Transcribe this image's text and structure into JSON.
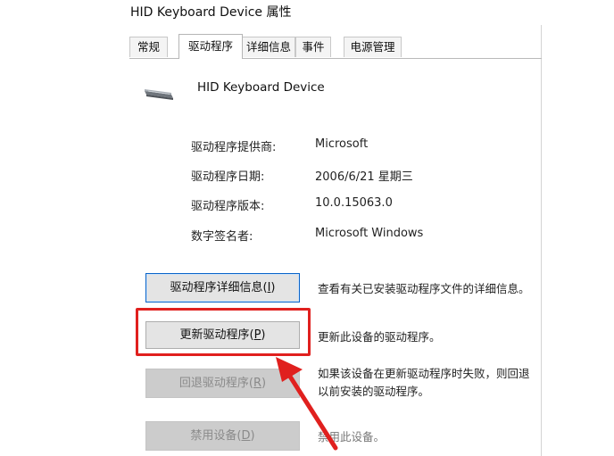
{
  "window": {
    "title": "HID Keyboard Device 属性"
  },
  "tabs": [
    {
      "label": "常规"
    },
    {
      "label": "驱动程序"
    },
    {
      "label": "详细信息"
    },
    {
      "label": "事件"
    },
    {
      "label": "电源管理"
    }
  ],
  "active_tab_index": 1,
  "device": {
    "name": "HID Keyboard Device",
    "icon": "keyboard-icon"
  },
  "info": {
    "provider_label": "驱动程序提供商:",
    "provider_value": "Microsoft",
    "date_label": "驱动程序日期:",
    "date_value": "2006/6/21 星期三",
    "version_label": "驱动程序版本:",
    "version_value": "10.0.15063.0",
    "signer_label": "数字签名者:",
    "signer_value": "Microsoft Windows"
  },
  "buttons": {
    "details": {
      "label": "驱动程序详细信息(",
      "key": "I",
      "tail": ")"
    },
    "update": {
      "label": "更新驱动程序(",
      "key": "P",
      "tail": ")"
    },
    "rollback": {
      "label": "回退驱动程序(",
      "key": "R",
      "tail": ")"
    },
    "disable": {
      "label": "禁用设备(",
      "key": "D",
      "tail": ")"
    }
  },
  "descriptions": {
    "details": "查看有关已安装驱动程序文件的详细信息。",
    "update": "更新此设备的驱动程序。",
    "rollback_line1": "如果该设备在更新驱动程序时失败，则回退",
    "rollback_line2": "以前安装的驱动程序。",
    "disable": "禁用此设备。"
  },
  "annotation": {
    "color": "#e0201e"
  }
}
